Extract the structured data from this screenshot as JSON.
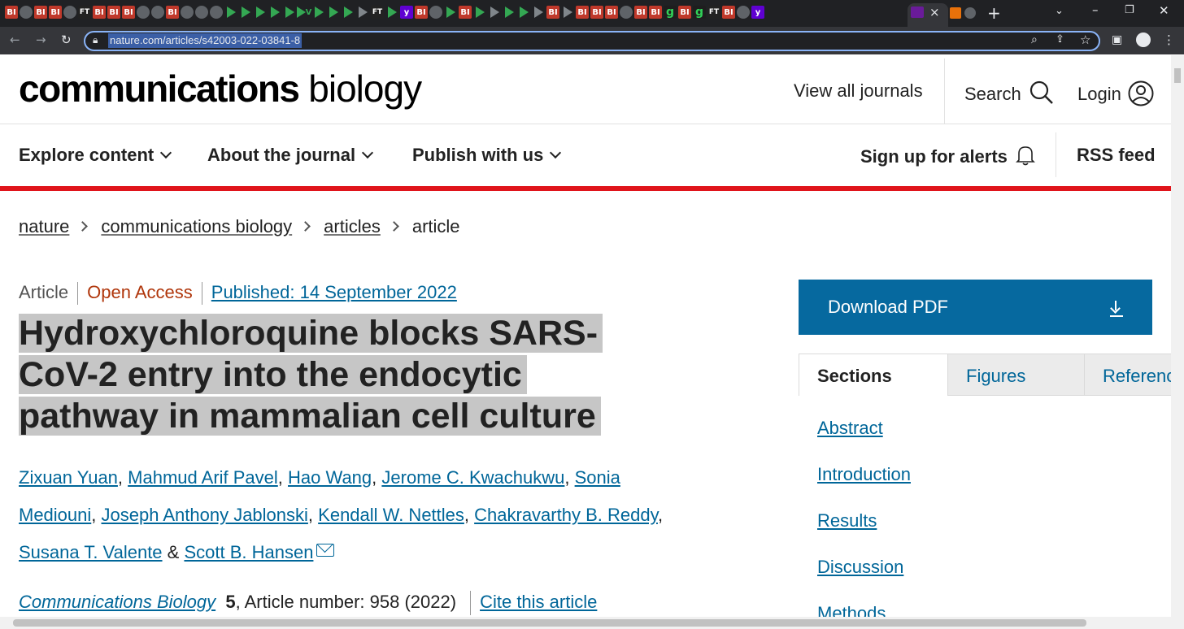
{
  "browser": {
    "url": "nature.com/articles/s42003-022-03841-8",
    "tab_icons": [
      "BI",
      "glob",
      "BI",
      "BI",
      "glob",
      "FT",
      "BI",
      "BI",
      "BI",
      "glob",
      "glob",
      "BI",
      "glob",
      "glob",
      "glob",
      "play",
      "play",
      "play",
      "play",
      "play",
      "v",
      "play",
      "play",
      "play",
      "grey",
      "ft",
      "play",
      "y",
      "BI",
      "glob",
      "play",
      "BI",
      "play",
      "grey",
      "play",
      "play",
      "grey",
      "BI",
      "grey",
      "BI",
      "BI",
      "BI",
      "glob",
      "BI",
      "BI",
      "g",
      "BI",
      "g",
      "FT",
      "BI",
      "glob",
      "y"
    ],
    "new_tab_label": "+",
    "close_tab_label": "×"
  },
  "header": {
    "logo_bold": "communications",
    "logo_light": "biology",
    "view_all": "View all journals",
    "search": "Search",
    "login": "Login"
  },
  "nav": {
    "explore": "Explore content",
    "about": "About the journal",
    "publish": "Publish with us",
    "alerts": "Sign up for alerts",
    "rss": "RSS feed"
  },
  "breadcrumb": [
    "nature",
    "communications biology",
    "articles",
    "article"
  ],
  "article": {
    "type": "Article",
    "access": "Open Access",
    "published": "Published: 14 September 2022",
    "title": "Hydroxychloroquine blocks SARS-CoV-2 entry into the endocytic pathway in mammalian cell culture",
    "authors": [
      "Zixuan Yuan",
      "Mahmud Arif Pavel",
      "Hao Wang",
      "Jerome C. Kwachukwu",
      "Sonia Mediouni",
      "Joseph Anthony Jablonski",
      "Kendall W. Nettles",
      "Chakravarthy B. Reddy",
      "Susana T. Valente",
      "Scott B. Hansen"
    ],
    "journal": "Communications Biology",
    "volume": "5",
    "article_number": ", Article number: 958 (2022)",
    "cite": "Cite this article"
  },
  "sidebar": {
    "download": "Download PDF",
    "tabs": [
      "Sections",
      "Figures",
      "References"
    ],
    "sections": [
      "Abstract",
      "Introduction",
      "Results",
      "Discussion",
      "Methods"
    ]
  }
}
